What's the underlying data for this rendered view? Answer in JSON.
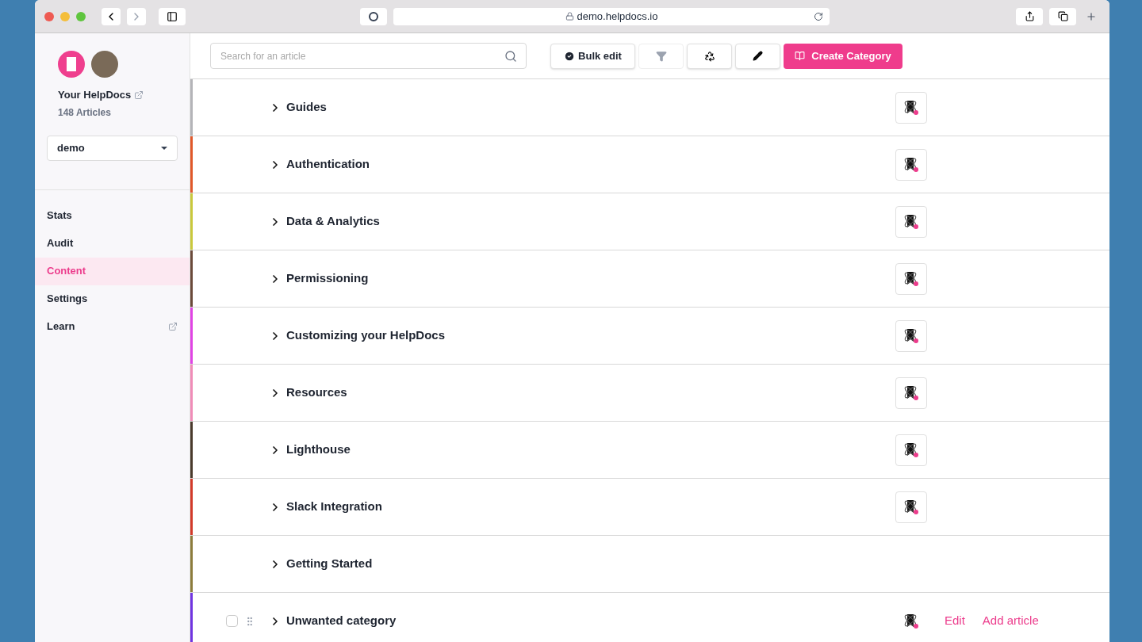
{
  "browser": {
    "url": "demo.helpdocs.io"
  },
  "sidebar": {
    "site_name": "Your HelpDocs",
    "article_count": "148 Articles",
    "workspace": "demo",
    "items": [
      {
        "label": "Stats",
        "selected": false,
        "external": false
      },
      {
        "label": "Audit",
        "selected": false,
        "external": false
      },
      {
        "label": "Content",
        "selected": true,
        "external": false
      },
      {
        "label": "Settings",
        "selected": false,
        "external": false
      },
      {
        "label": "Learn",
        "selected": false,
        "external": true
      }
    ]
  },
  "toolbar": {
    "search": {
      "placeholder": "Search for an article"
    },
    "bulk_edit": "Bulk edit",
    "create": "Create Category"
  },
  "categories": [
    {
      "name": "Guides",
      "color": "#b4b4b8",
      "kind": "plain",
      "has_icon": true
    },
    {
      "name": "Authentication",
      "color": "#e0582a",
      "kind": "plain",
      "has_icon": true
    },
    {
      "name": "Data & Analytics",
      "color": "#c9c83c",
      "kind": "plain",
      "has_icon": true
    },
    {
      "name": "Permissioning",
      "color": "#6b4a3a",
      "kind": "plain",
      "has_icon": true
    },
    {
      "name": "Customizing your HelpDocs",
      "color": "#e044e4",
      "kind": "plain",
      "has_icon": true
    },
    {
      "name": "Resources",
      "color": "#f08cb8",
      "kind": "plain",
      "has_icon": true
    },
    {
      "name": "Lighthouse",
      "color": "#4a3a2c",
      "kind": "plain",
      "has_icon": true
    },
    {
      "name": "Slack Integration",
      "color": "#d23a2a",
      "kind": "plain",
      "has_icon": true
    },
    {
      "name": "Getting Started",
      "color": "#8c7c3c",
      "kind": "plain",
      "has_icon": false
    },
    {
      "name": "Unwanted category",
      "color": "#7034e0",
      "kind": "hovered",
      "has_icon": true,
      "checked": false,
      "actions": [
        "Edit",
        "Add article"
      ]
    }
  ]
}
